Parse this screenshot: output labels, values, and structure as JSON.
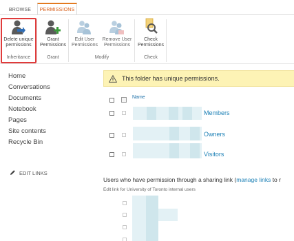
{
  "ribbon": {
    "tabs": [
      {
        "label": "BROWSE",
        "active": false
      },
      {
        "label": "PERMISSIONS",
        "active": true
      }
    ],
    "buttons": {
      "delete_unique": {
        "label_line1": "Delete unique",
        "label_line2": "permissions",
        "icon": "delete-permissions-icon"
      },
      "grant": {
        "label_line1": "Grant",
        "label_line2": "Permissions",
        "icon": "grant-permissions-icon"
      },
      "edit_user": {
        "label_line1": "Edit User",
        "label_line2": "Permissions",
        "icon": "edit-user-permissions-icon"
      },
      "remove_user": {
        "label_line1": "Remove User",
        "label_line2": "Permissions",
        "icon": "remove-user-permissions-icon"
      },
      "check": {
        "label_line1": "Check",
        "label_line2": "Permissions",
        "icon": "check-permissions-icon"
      }
    },
    "groups": {
      "inheritance": "Inheritance",
      "grant": "Grant",
      "modify": "Modify",
      "check": "Check"
    },
    "highlight_color": "#e03b3b",
    "accent_color": "#e37a20"
  },
  "nav": {
    "items": [
      "Home",
      "Conversations",
      "Documents",
      "Notebook",
      "Pages",
      "Site contents",
      "Recycle Bin"
    ],
    "edit_links": "EDIT LINKS"
  },
  "main": {
    "notice": "This folder has unique permissions.",
    "column_name": "Name",
    "groups": [
      "Members",
      "Owners",
      "Visitors"
    ],
    "share_prefix": "Users who have permission through a sharing link (",
    "share_link": "manage links",
    "share_suffix": " to r",
    "share_sub": "Edit link for University of Toronto internal users"
  }
}
